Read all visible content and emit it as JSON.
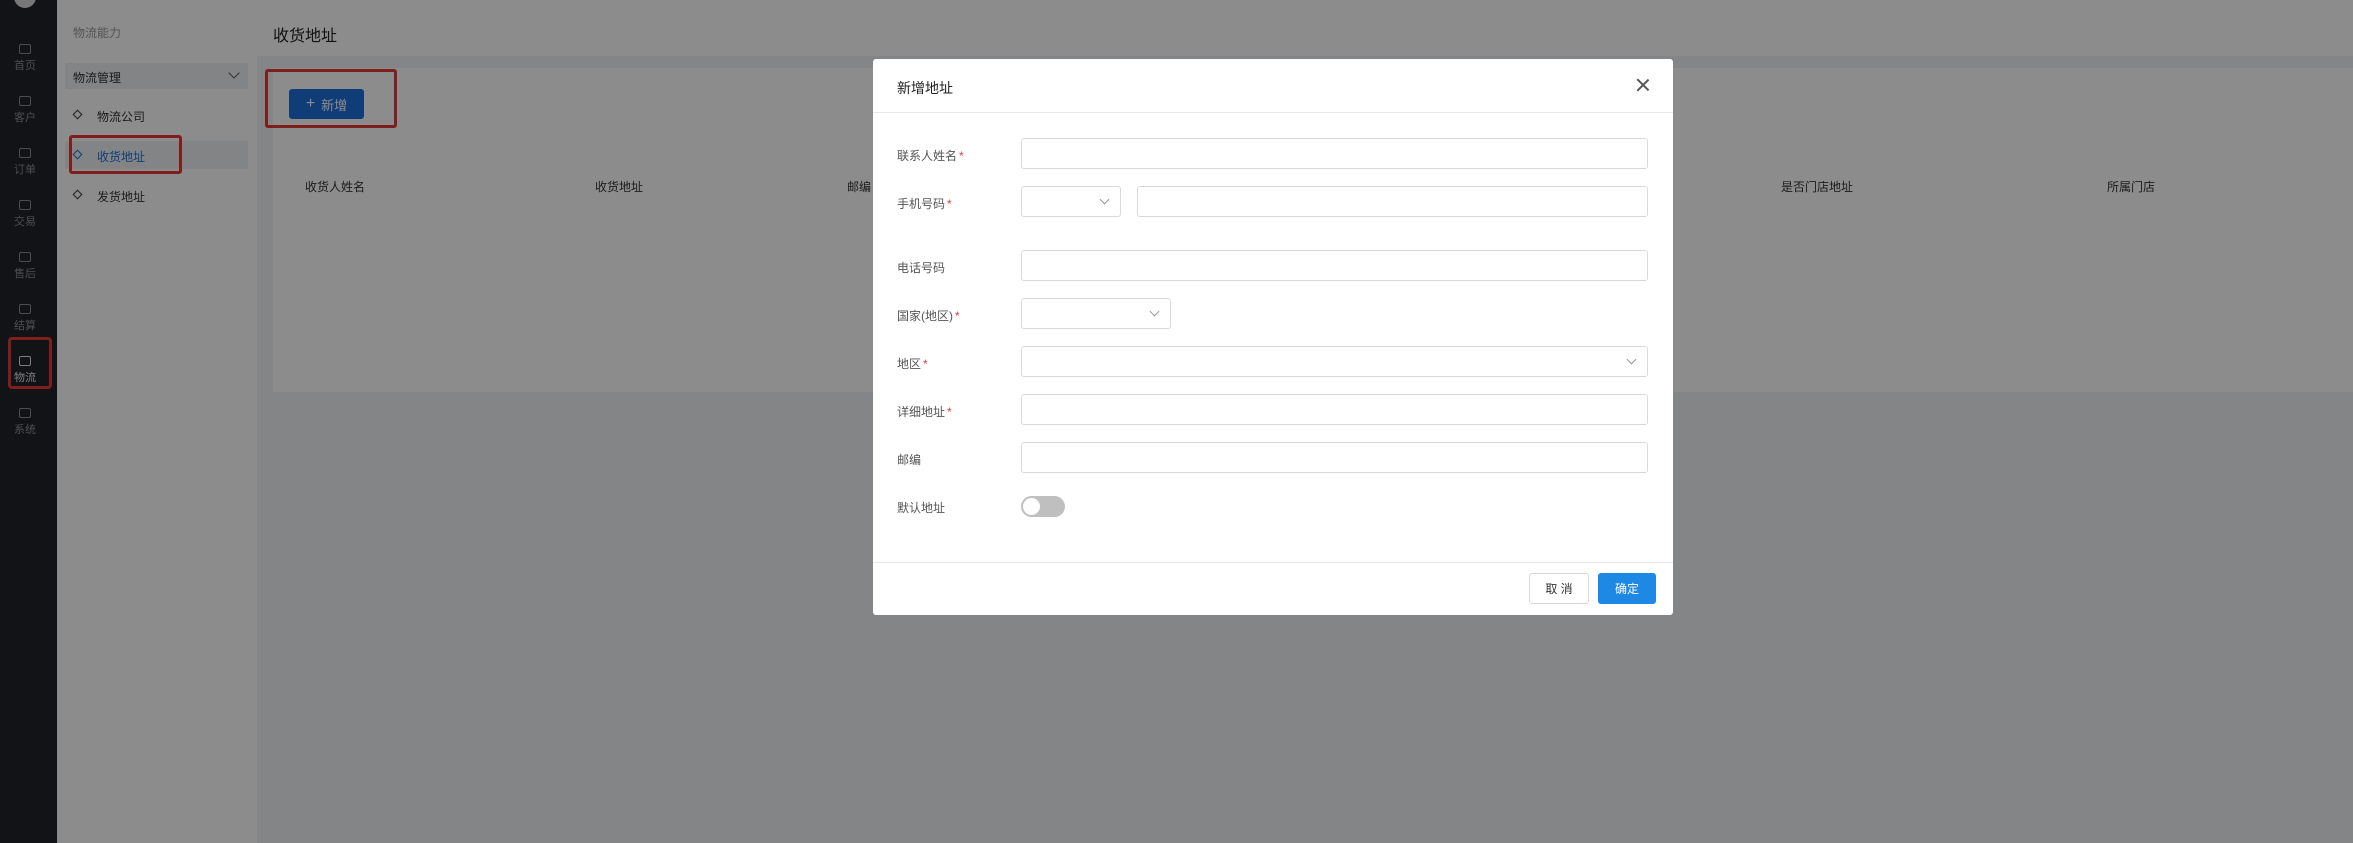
{
  "rail": {
    "items": [
      {
        "label": "首页",
        "icon": "home-icon"
      },
      {
        "label": "客户",
        "icon": "customer-icon"
      },
      {
        "label": "订单",
        "icon": "order-icon"
      },
      {
        "label": "交易",
        "icon": "trade-icon"
      },
      {
        "label": "售后",
        "icon": "after-sales-icon"
      },
      {
        "label": "结算",
        "icon": "settlement-icon"
      },
      {
        "label": "物流",
        "icon": "logistics-icon"
      },
      {
        "label": "系统",
        "icon": "system-icon"
      }
    ]
  },
  "sidebar": {
    "title": "物流能力",
    "group": "物流管理",
    "items": [
      "物流公司",
      "收货地址",
      "发货地址"
    ]
  },
  "main": {
    "title": "收货地址",
    "add_button": "新增",
    "columns": [
      "收货人姓名",
      "收货地址",
      "邮编",
      "是否门店地址",
      "所属门店"
    ]
  },
  "modal": {
    "title": "新增地址",
    "fields": {
      "contact_name": "联系人姓名",
      "mobile": "手机号码",
      "phone": "电话号码",
      "country": "国家(地区)",
      "region": "地区",
      "detail_address": "详细地址",
      "zip": "邮编",
      "default_address": "默认地址"
    },
    "required_mark": "*",
    "default_on": false,
    "cancel": "取 消",
    "confirm": "确定"
  },
  "colors": {
    "primary": "#1e6fd9",
    "confirm": "#1e88e5",
    "highlight": "#e53935",
    "rail": "#1f2329"
  }
}
